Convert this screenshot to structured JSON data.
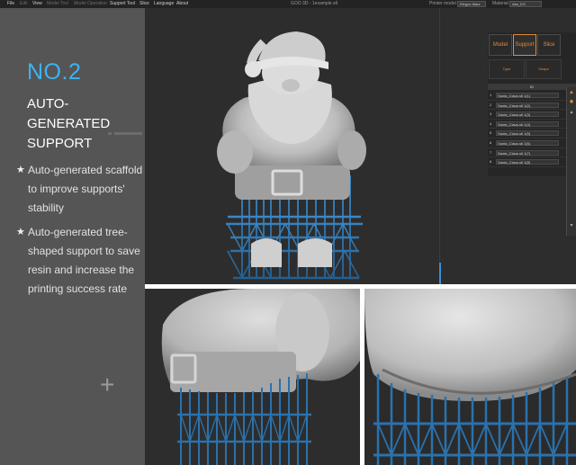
{
  "menubar": {
    "items": [
      "File",
      "Edit",
      "View",
      "Model Tool",
      "Model Operation",
      "Support Tool",
      "Slice",
      "Language",
      "About"
    ],
    "title": "GOO 3D - 1example.stl",
    "printer_label": "Printer model",
    "printer_value": "Elegoo Mars",
    "material_label": "Material",
    "material_value": "Abs_EG"
  },
  "promo": {
    "number": "NO.2",
    "heading": "AUTO-GENERATED SUPPORT",
    "bullets": [
      "Auto-generated scaffold to improve supports' stability",
      "Auto-generated tree-shaped support to save resin and increase the printing success rate"
    ],
    "plus_symbol": "+"
  },
  "panel": {
    "tabs": [
      "Model",
      "Support",
      "Slice"
    ],
    "active_tab": "Support",
    "buttons": [
      "Type",
      "Shape"
    ],
    "list_header": "ID",
    "files": [
      {
        "id": "1",
        "name": "Santa_Claus.stl 1(1)"
      },
      {
        "id": "2",
        "name": "Santa_Claus.stl 1(2)"
      },
      {
        "id": "3",
        "name": "Santa_Claus.stl 1(3)"
      },
      {
        "id": "4",
        "name": "Santa_Claus.stl 1(4)"
      },
      {
        "id": "5",
        "name": "Santa_Claus.stl 1(5)"
      },
      {
        "id": "6",
        "name": "Santa_Claus.stl 1(6)"
      },
      {
        "id": "7",
        "name": "Santa_Claus.stl 1(7)"
      },
      {
        "id": "8",
        "name": "Santa_Claus.stl 1(8)"
      }
    ]
  },
  "colors": {
    "accent_blue": "#3db3f2",
    "support_blue": "#2a6fa5",
    "ui_orange": "#e08b3a",
    "panel_gray": "#555555",
    "viewport_bg": "#2d2d2d",
    "model_gray": "#bdbdbd"
  },
  "icons": [
    "star-bullet-icon",
    "plus-icon",
    "warning-icon",
    "gear-icon",
    "up-arrow-icon",
    "down-arrow-icon"
  ]
}
